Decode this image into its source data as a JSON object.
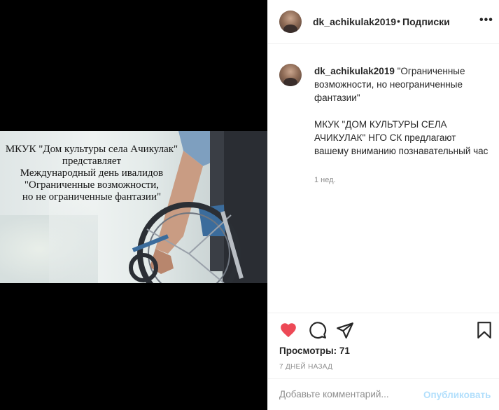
{
  "post": {
    "username": "dk_achikulak2019",
    "dot": "•",
    "follow_label": "Подписки",
    "more_label": "•••",
    "image_text": {
      "line1": "МКУК \"Дом культуры села Ачикулак\"",
      "line2": "представляет",
      "line3": "Международный день ивалидов",
      "line4": "\"Ограниченные возможности,",
      "line5": "но не ограниченные фантазии\""
    },
    "caption_username": "dk_achikulak2019",
    "caption_title": "\"Ограниченные возможности, но неограниченные фантазии\"",
    "caption_body": "МКУК \"ДОМ КУЛЬТУРЫ СЕЛА АЧИКУЛАК\" НГО СК предлагают вашему вниманию познавательный час",
    "time_ago": "1 нед.",
    "views_label": "Просмотры:",
    "views_count": "71",
    "date": "7 дней назад",
    "comment_placeholder": "Добавьте комментарий...",
    "publish_label": "Опубликовать"
  },
  "colors": {
    "heart": "#ed4956",
    "publish_disabled": "#b2dffc",
    "muted": "#8e8e8e"
  },
  "icons": [
    "heart-icon",
    "comment-icon",
    "share-icon",
    "bookmark-icon",
    "more-icon"
  ]
}
